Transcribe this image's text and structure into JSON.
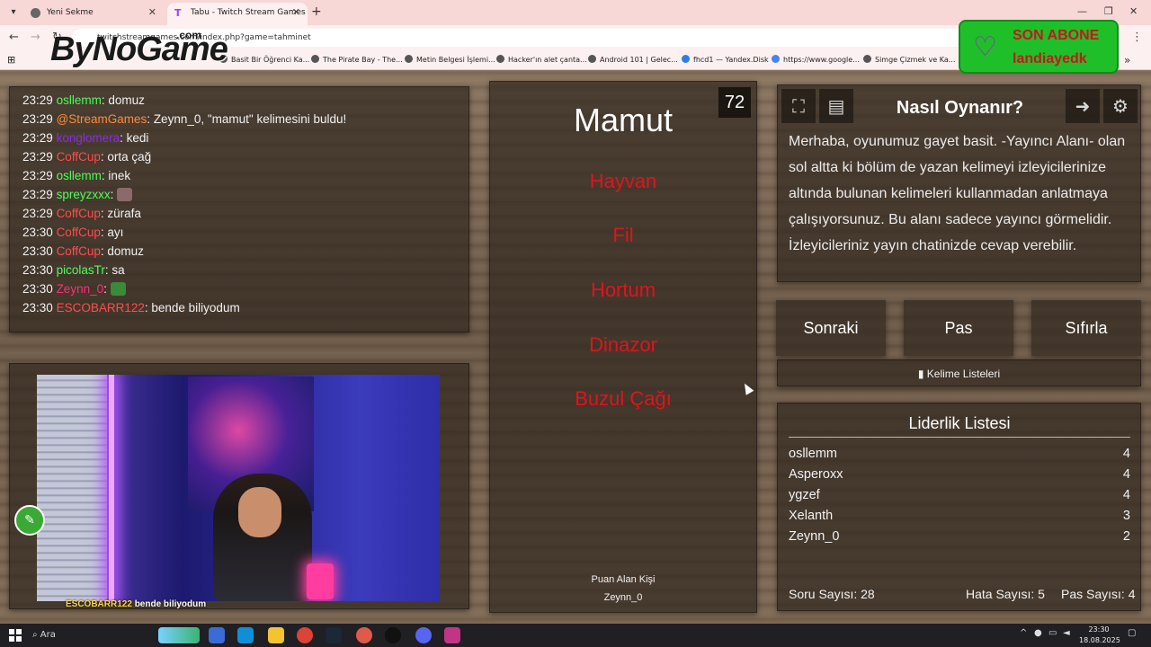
{
  "browser": {
    "tabs": [
      {
        "title": "Yeni Sekme"
      },
      {
        "title": "Tabu - Twitch Stream Games"
      }
    ],
    "url": "twitchstreamgames.com/index.php?game=tahminet",
    "bookmarks": [
      "Basit Bir Öğrenci Ka...",
      "The Pirate Bay - The...",
      "Metin Belgesi İşlemi...",
      "Hacker'ın alet çanta...",
      "Android 101 | Gelec...",
      "fhcd1 — Yandex.Disk",
      "https://www.google...",
      "Simge Çizmek ve Ka..."
    ]
  },
  "overlay": {
    "brand": "ByNoGame",
    "brand_suffix": ".com",
    "sub_label": "SON ABONE",
    "sub_name": "landiayedk"
  },
  "chat": [
    {
      "time": "23:29",
      "user": "osllemm",
      "color": "#4cff5a",
      "msg": "domuz"
    },
    {
      "time": "23:29",
      "user": "@StreamGames",
      "color": "#ff8c3a",
      "msg": "Zeynn_0, \"mamut\" kelimesini buldu!"
    },
    {
      "time": "23:29",
      "user": "konglomera",
      "color": "#8a2be2",
      "msg": "kedi"
    },
    {
      "time": "23:29",
      "user": "CoffCup",
      "color": "#ff4d4d",
      "msg": "orta çağ"
    },
    {
      "time": "23:29",
      "user": "osllemm",
      "color": "#4cff5a",
      "msg": "inek"
    },
    {
      "time": "23:29",
      "user": "spreyzxxx",
      "color": "#4cff5a",
      "msg": "",
      "emote": "#8a6a6a"
    },
    {
      "time": "23:29",
      "user": "CoffCup",
      "color": "#ff4d4d",
      "msg": "zürafa"
    },
    {
      "time": "23:30",
      "user": "CoffCup",
      "color": "#ff4d4d",
      "msg": "ayı"
    },
    {
      "time": "23:30",
      "user": "CoffCup",
      "color": "#ff4d4d",
      "msg": "domuz"
    },
    {
      "time": "23:30",
      "user": "picolasTr",
      "color": "#4cff5a",
      "msg": "sa"
    },
    {
      "time": "23:30",
      "user": "Zeynn_0",
      "color": "#ff2f7a",
      "msg": "",
      "emote": "#3a8a3a"
    },
    {
      "time": "23:30",
      "user": "ESCOBARR122",
      "color": "#ff4d4d",
      "msg": "bende biliyodum"
    }
  ],
  "stream": {
    "caption_user": "ESCOBARR122",
    "caption_msg": "bende biliyodum"
  },
  "card": {
    "timer": "72",
    "word": "Mamut",
    "taboo": [
      "Hayvan",
      "Fil",
      "Hortum",
      "Dinazor",
      "Buzul Çağı"
    ],
    "scorer_label": "Puan Alan Kişi",
    "scorer_name": "Zeynn_0"
  },
  "howto": {
    "title": "Nasıl Oynanır?",
    "text": "Merhaba, oyunumuz gayet basit. -Yayıncı Alanı- olan sol altta ki bölüm de yazan kelimeyi izleyicilerinize altında bulunan kelimeleri kullanmadan anlatmaya çalışıyorsunuz. Bu alanı sadece yayıncı görmelidir. İzleyicileriniz yayın chatinizde cevap verebilir."
  },
  "actions": {
    "next": "Sonraki",
    "pass": "Pas",
    "reset": "Sıfırla",
    "word_lists": "Kelime Listeleri"
  },
  "leaderboard": {
    "title": "Liderlik Listesi",
    "rows": [
      {
        "name": "osllemm",
        "score": "4"
      },
      {
        "name": "Asperoxx",
        "score": "4"
      },
      {
        "name": "ygzef",
        "score": "4"
      },
      {
        "name": "Xelanth",
        "score": "3"
      },
      {
        "name": "Zeynn_0",
        "score": "2"
      }
    ],
    "questions": "Soru Sayısı: 28",
    "errors": "Hata Sayısı: 5",
    "passes": "Pas Sayısı: 4"
  },
  "taskbar": {
    "search": "Ara",
    "time": "23:30",
    "date": "18.08.2025"
  },
  "colors": {
    "taboo": "#e0141c",
    "sub_badge": "#1fbf2a",
    "tab_bar": "#f8d7d7"
  }
}
